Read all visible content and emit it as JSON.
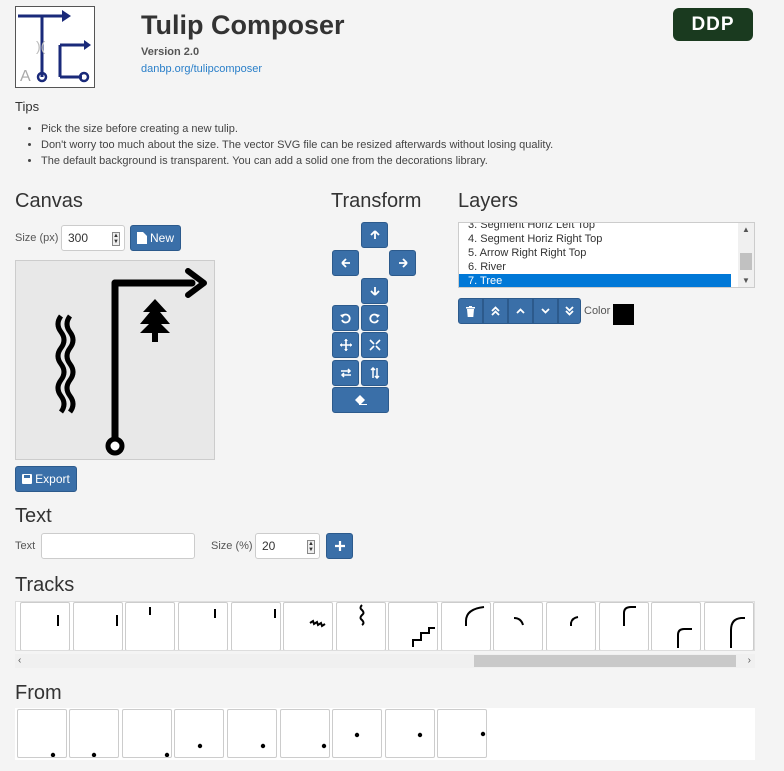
{
  "app": {
    "title": "Tulip Composer",
    "version": "Version 2.0",
    "link": "danbp.org/tulipcomposer",
    "badge": "DDP"
  },
  "tips": {
    "title": "Tips",
    "items": [
      "Pick the size before creating a new tulip.",
      "Don't worry too much about the size. The vector SVG file can be resized afterwards without losing quality.",
      "The default background is transparent. You can add a solid one from the decorations library."
    ]
  },
  "canvas": {
    "heading": "Canvas",
    "size_label": "Size (px)",
    "size_value": "300",
    "new_label": "New",
    "export_label": "Export"
  },
  "transform": {
    "heading": "Transform",
    "buttons": [
      "arrow-up",
      "arrow-left",
      "arrow-right",
      "arrow-down",
      "rotate-left",
      "rotate-right",
      "move",
      "shrink",
      "flip-horizontal",
      "flip-vertical",
      "erase"
    ]
  },
  "layers": {
    "heading": "Layers",
    "items": [
      "3. Segment Horiz Left Top",
      "4. Segment Horiz Right Top",
      "5. Arrow Right Right Top",
      "6. River",
      "7. Tree"
    ],
    "selected_index": 4,
    "color_label": "Color",
    "color_value": "#000000",
    "tools": [
      "trash",
      "move-to-top",
      "move-up",
      "move-down",
      "move-to-bottom"
    ]
  },
  "text": {
    "heading": "Text",
    "text_label": "Text",
    "text_value": "",
    "size_label": "Size (%)",
    "size_value": "20"
  },
  "tracks": {
    "heading": "Tracks",
    "count": 14
  },
  "from": {
    "heading": "From",
    "count": 9
  },
  "colors": {
    "accent": "#3a6fa8",
    "selection": "#0078d7",
    "brand": "#1a3a1f",
    "logo_blue": "#1a2a7a"
  }
}
